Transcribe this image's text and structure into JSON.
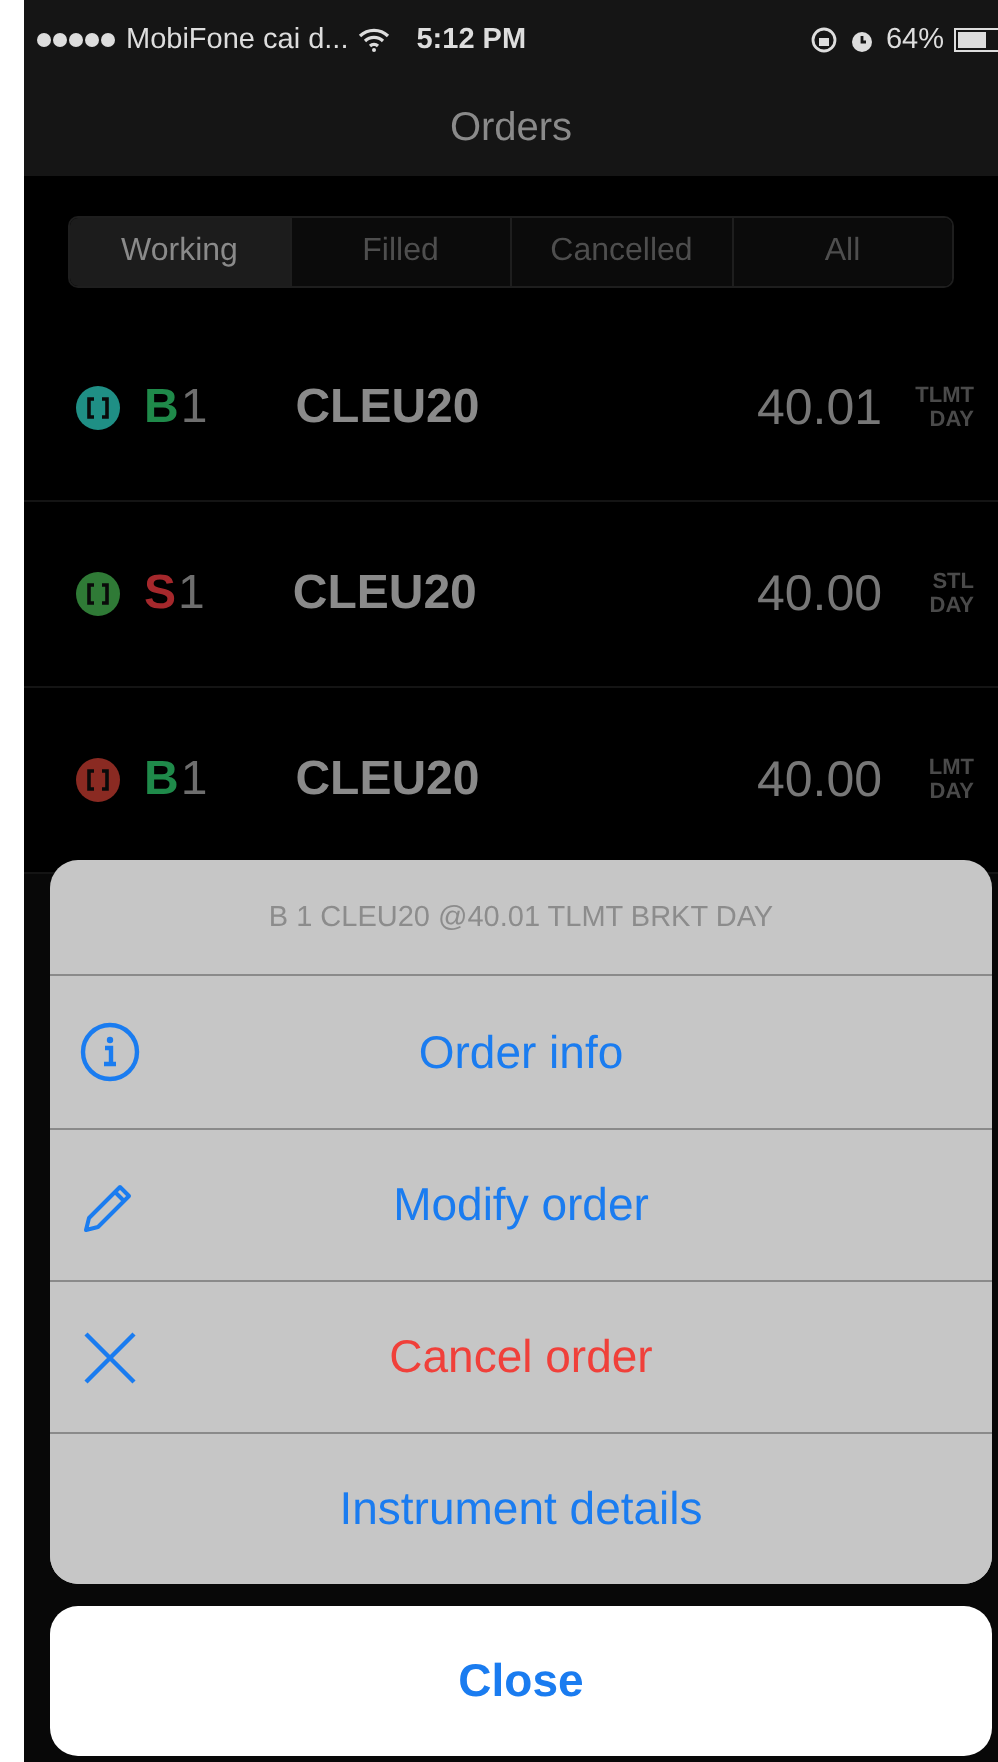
{
  "status_bar": {
    "carrier": "MobiFone cai d...",
    "time": "5:12 PM",
    "battery": "64%"
  },
  "nav": {
    "title": "Orders"
  },
  "tabs": [
    {
      "label": "Working",
      "selected": true
    },
    {
      "label": "Filled",
      "selected": false
    },
    {
      "label": "Cancelled",
      "selected": false
    },
    {
      "label": "All",
      "selected": false
    }
  ],
  "orders": [
    {
      "color": "#1f8f85",
      "side": "B",
      "kind": "buy",
      "qty": "1",
      "symbol": "CLEU20",
      "price": "40.01",
      "type": "TLMT",
      "tif": "DAY"
    },
    {
      "color": "#2f7a36",
      "side": "S",
      "kind": "sell",
      "qty": "1",
      "symbol": "CLEU20",
      "price": "40.00",
      "type": "STL",
      "tif": "DAY"
    },
    {
      "color": "#8a2a22",
      "side": "B",
      "kind": "buy",
      "qty": "1",
      "symbol": "CLEU20",
      "price": "40.00",
      "type": "LMT",
      "tif": "DAY"
    }
  ],
  "action_sheet": {
    "header": "B 1 CLEU20 @40.01 TLMT BRKT DAY",
    "actions": [
      {
        "label": "Order info",
        "kind": "info",
        "destructive": false
      },
      {
        "label": "Modify order",
        "kind": "edit",
        "destructive": false
      },
      {
        "label": "Cancel order",
        "kind": "cancel",
        "destructive": true
      },
      {
        "label": "Instrument details",
        "kind": "plain",
        "destructive": false
      }
    ],
    "close": "Close"
  }
}
